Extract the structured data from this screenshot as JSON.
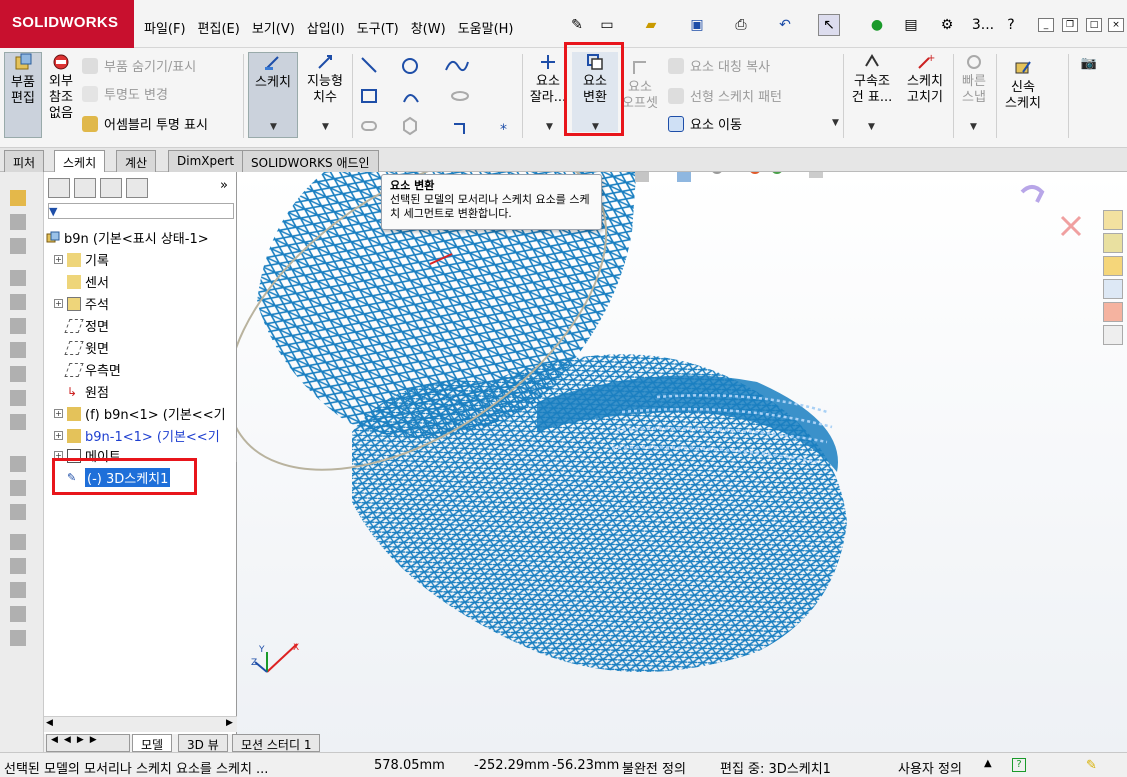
{
  "app": {
    "logo_text": "SOLIDWORKS",
    "brand_color": "#c8102e"
  },
  "menu": [
    "파일(F)",
    "편집(E)",
    "보기(V)",
    "삽입(I)",
    "도구(T)",
    "창(W)",
    "도움말(H)"
  ],
  "quick_access": {
    "search_abbrev": "3..."
  },
  "ribbon": {
    "part_edit": "부품\n편집",
    "external_ref": "외부\n참조\n없음",
    "hide_show": "부품 숨기기/표시",
    "transparency": "투명도 변경",
    "assembly_transparent": "어셈블리 투명 표시",
    "sketch": "스케치",
    "smart_dim": "지능형\n치수",
    "trim": "요소\n잘라...",
    "convert": "요소\n변환",
    "offset": "요소\n오프셋",
    "mirror": "요소 대칭 복사",
    "linear_pattern": "선형 스케치 패턴",
    "move": "요소 이동",
    "relations": "구속조\n건 표...",
    "repair": "스케치\n고치기",
    "quick_snap": "빠른\n스냅",
    "rapid_sketch": "신속\n스케치"
  },
  "tabs": [
    "피처",
    "스케치",
    "계산",
    "DimXpert",
    "SOLIDWORKS 애드인"
  ],
  "active_tab": "스케치",
  "tooltip": {
    "title": "요소 변환",
    "body": "선택된 모델의 모서리나 스케치 요소를 스케치 세그먼트로 변환합니다."
  },
  "tree": {
    "root": "b9n  (기본<표시 상태-1>",
    "items": [
      "기록",
      "센서",
      "주석",
      "정면",
      "윗면",
      "우측면",
      "원점",
      "(f) b9n<1> (기본<<기",
      "b9n-1<1> (기본<<기",
      "메이트",
      "(-) 3D스케치1"
    ]
  },
  "bottom_tabs": [
    "모델",
    "3D 뷰",
    "모션 스터디 1"
  ],
  "status": {
    "message": "선택된 모델의 모서리나 스케치 요소를 스케치 ...",
    "x": "578.05mm",
    "y": "-252.29mm",
    "z": "-56.23mm",
    "definition": "불완전 정의",
    "editing": "편집 중: 3D스케치1",
    "units": "사용자 정의"
  },
  "colors": {
    "model_blue": "#1a7fc1",
    "highlight": "#e8151b"
  },
  "viewport": {
    "triad_axes": [
      "Y",
      "Z",
      "X"
    ]
  }
}
